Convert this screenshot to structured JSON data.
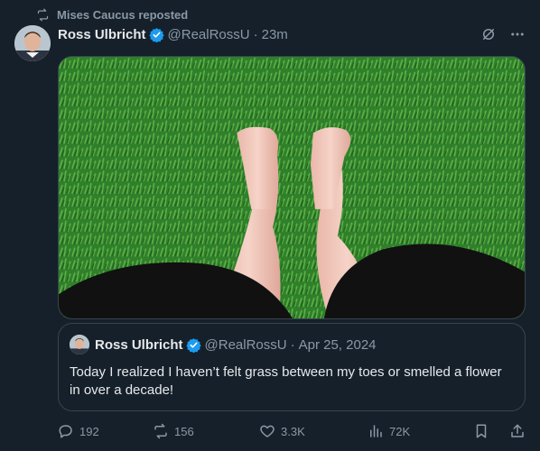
{
  "repost": {
    "label": "Mises Caucus reposted"
  },
  "post": {
    "author_name": "Ross Ulbricht",
    "author_handle": "@RealRossU",
    "separator": "·",
    "time": "23m"
  },
  "quote": {
    "author_name": "Ross Ulbricht",
    "author_handle": "@RealRossU",
    "separator": "·",
    "date": "Apr 25, 2024",
    "text": "Today I realized I haven’t felt grass between my toes or smelled a flower in over a decade!"
  },
  "stats": {
    "replies": "192",
    "reposts": "156",
    "likes": "3.3K",
    "views": "72K"
  },
  "colors": {
    "background": "#15202b",
    "text_primary": "#e7e9ea",
    "text_secondary": "#8b98a5",
    "verified_blue": "#1d9bf0",
    "border": "#38444d"
  },
  "icons": {
    "repost": "repost-icon",
    "verified": "verified-badge-icon",
    "grok": "grok-icon",
    "more": "more-icon",
    "reply": "reply-icon",
    "like": "heart-icon",
    "views": "views-icon",
    "bookmark": "bookmark-icon",
    "share": "share-icon"
  }
}
